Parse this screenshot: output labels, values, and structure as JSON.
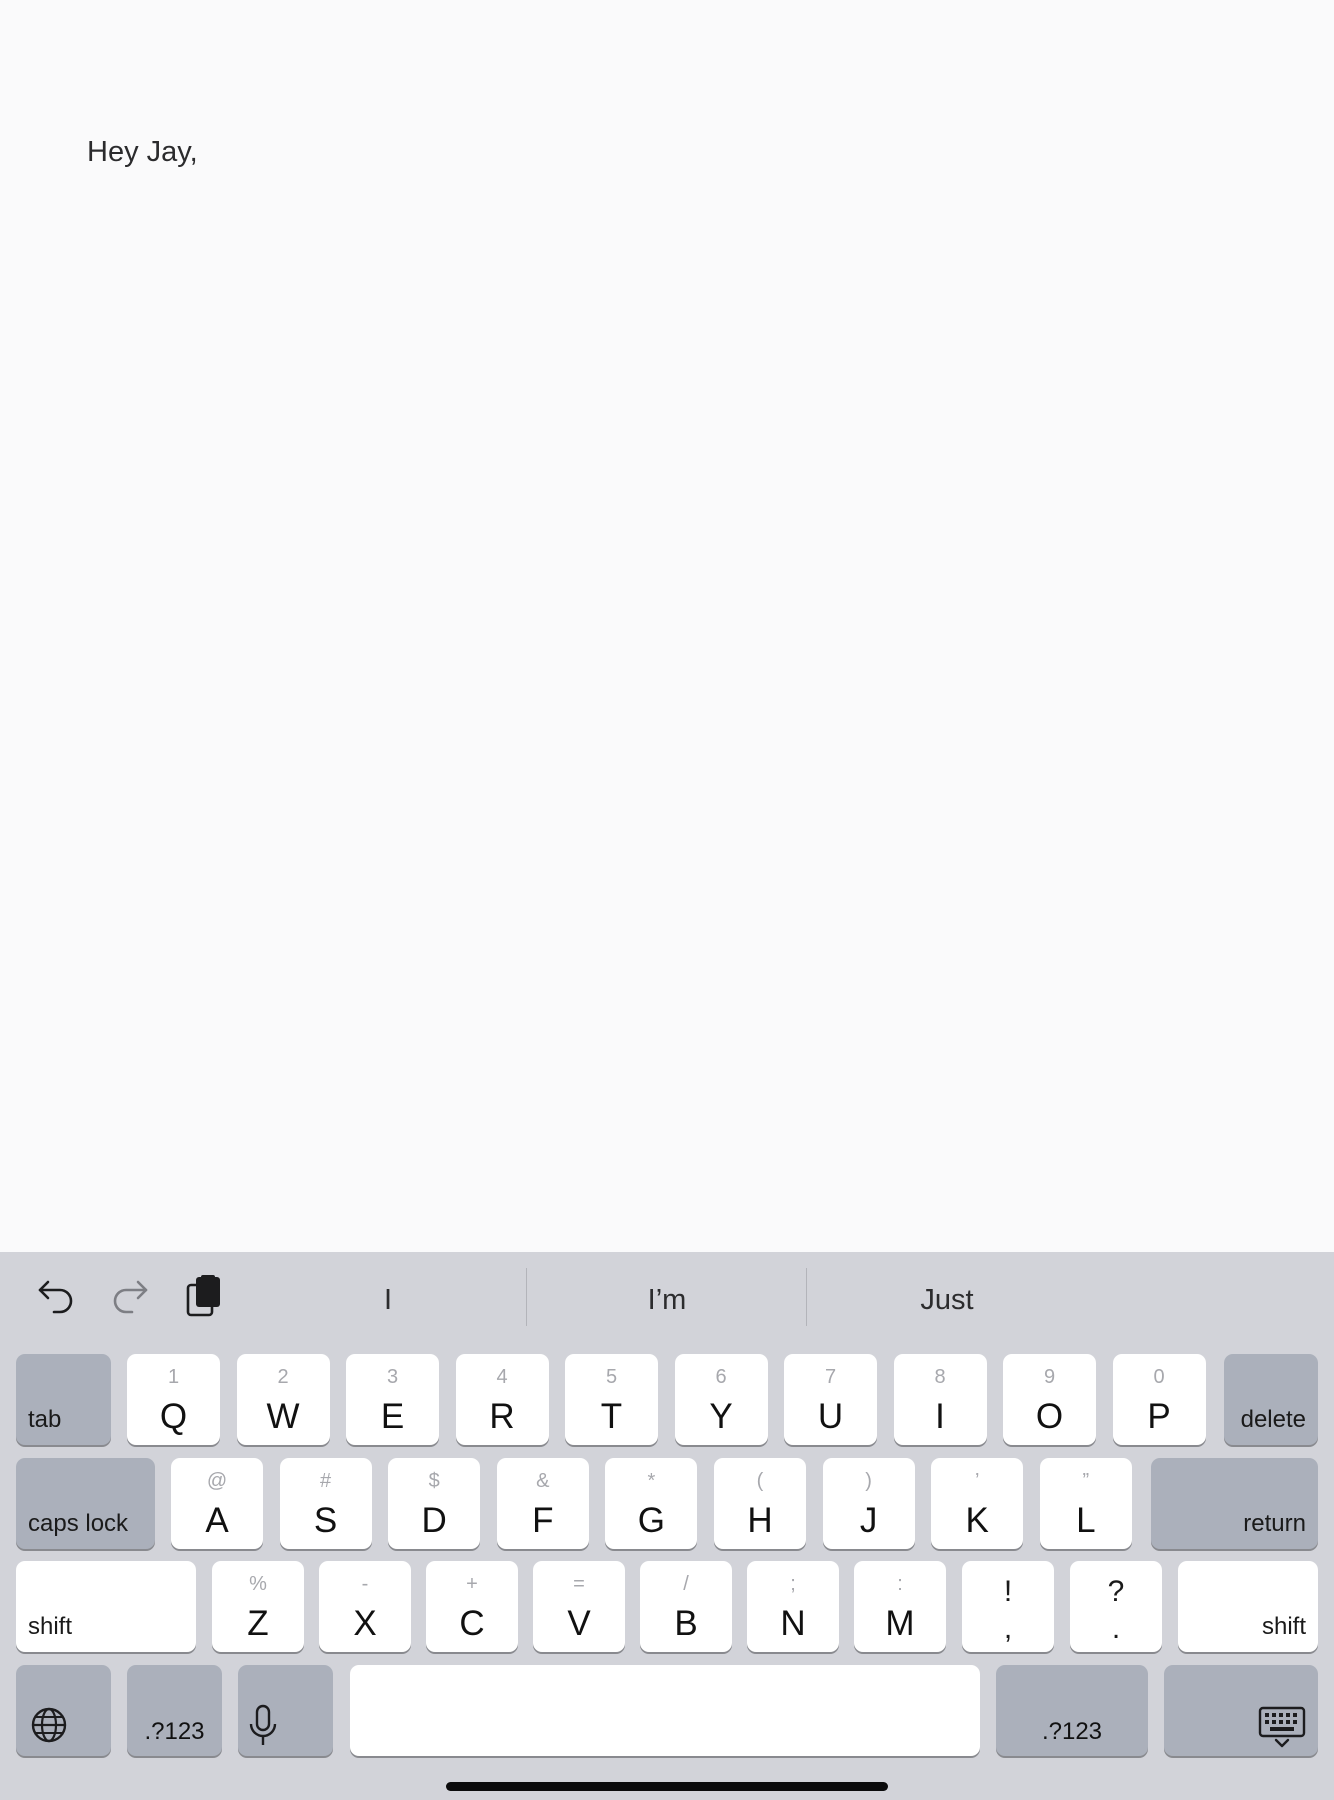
{
  "document": {
    "text": "Hey Jay,"
  },
  "toolbar": {
    "undo_icon": "undo-arrow-icon",
    "redo_icon": "redo-arrow-icon",
    "paste_icon": "clipboard-paste-icon",
    "suggestions": [
      "I",
      "I’m",
      "Just"
    ]
  },
  "keys": {
    "tab": "tab",
    "delete": "delete",
    "caps_lock": "caps lock",
    "return": "return",
    "shift_left": "shift",
    "shift_right": "shift",
    "numbers_left": ".?123",
    "numbers_right": ".?123",
    "row1": [
      {
        "main": "Q",
        "sub": "1"
      },
      {
        "main": "W",
        "sub": "2"
      },
      {
        "main": "E",
        "sub": "3"
      },
      {
        "main": "R",
        "sub": "4"
      },
      {
        "main": "T",
        "sub": "5"
      },
      {
        "main": "Y",
        "sub": "6"
      },
      {
        "main": "U",
        "sub": "7"
      },
      {
        "main": "I",
        "sub": "8"
      },
      {
        "main": "O",
        "sub": "9"
      },
      {
        "main": "P",
        "sub": "0"
      }
    ],
    "row2": [
      {
        "main": "A",
        "sub": "@"
      },
      {
        "main": "S",
        "sub": "#"
      },
      {
        "main": "D",
        "sub": "$"
      },
      {
        "main": "F",
        "sub": "&"
      },
      {
        "main": "G",
        "sub": "*"
      },
      {
        "main": "H",
        "sub": "("
      },
      {
        "main": "J",
        "sub": ")"
      },
      {
        "main": "K",
        "sub": "’"
      },
      {
        "main": "L",
        "sub": "”"
      }
    ],
    "row3": [
      {
        "main": "Z",
        "sub": "%"
      },
      {
        "main": "X",
        "sub": "-"
      },
      {
        "main": "C",
        "sub": "+"
      },
      {
        "main": "V",
        "sub": "="
      },
      {
        "main": "B",
        "sub": "/"
      },
      {
        "main": "N",
        "sub": ";"
      },
      {
        "main": "M",
        "sub": ":"
      }
    ],
    "punct": [
      {
        "top": "!",
        "bottom": ","
      },
      {
        "top": "?",
        "bottom": "."
      }
    ]
  }
}
